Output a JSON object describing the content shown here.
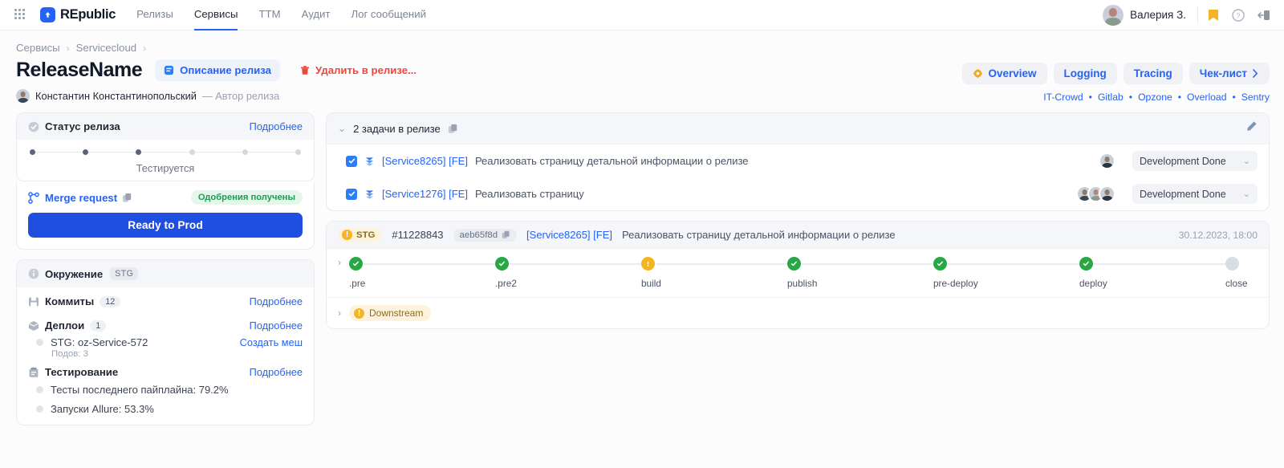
{
  "topnav": {
    "brand": "REpublic",
    "links": [
      {
        "label": "Релизы",
        "active": false
      },
      {
        "label": "Сервисы",
        "active": true
      },
      {
        "label": "TTM",
        "active": false
      },
      {
        "label": "Аудит",
        "active": false
      },
      {
        "label": "Лог сообщений",
        "active": false
      }
    ],
    "user": "Валерия З.",
    "icons": [
      "grid-icon",
      "bookmark-icon",
      "help-icon",
      "logout-icon"
    ],
    "bookmark_color": "#f5b424"
  },
  "breadcrumb": {
    "items": [
      "Сервисы",
      "Servicecloud"
    ],
    "sep": "›"
  },
  "header": {
    "title": "ReleaseName",
    "description_button": "Описание релиза",
    "delete_button": "Удалить в релизе...",
    "author_name": "Константин Константинопольский",
    "author_role": "— Автор релиза"
  },
  "right_head": {
    "tabs": [
      {
        "label": "Overview",
        "icon": "grafana-icon"
      },
      {
        "label": "Logging",
        "icon": ""
      },
      {
        "label": "Tracing",
        "icon": ""
      },
      {
        "label": "Чек-лист",
        "icon": "chevron-right-icon"
      }
    ],
    "links": [
      "IT-Crowd",
      "Gitlab",
      "Opzone",
      "Overload",
      "Sentry"
    ]
  },
  "status_card": {
    "title": "Статус релиза",
    "more": "Подробнее",
    "steps_total": 6,
    "steps_done": 3,
    "current_label": "Тестируется"
  },
  "merge_card": {
    "link": "Merge request",
    "badge": "Одобрения получены",
    "button": "Ready to Prod"
  },
  "env_card": {
    "title": "Окружение",
    "tag": "STG",
    "sections": [
      {
        "label": "Коммиты",
        "count": "12",
        "more": "Подробнее",
        "items": []
      },
      {
        "label": "Деплои",
        "count": "1",
        "more": "Подробнее",
        "items": [
          {
            "text": "STG: oz-Service-572",
            "action": "Создать меш",
            "note": "Подов: 3"
          }
        ]
      },
      {
        "label": "Тестирование",
        "count": "",
        "more": "Подробнее",
        "items": [
          {
            "text": "Тесты последнего пайплайна: 79.2%",
            "action": "",
            "note": ""
          },
          {
            "text": "Запуски Allure: 53.3%",
            "action": "",
            "note": ""
          }
        ]
      }
    ]
  },
  "tasks": {
    "header": "2 задачи в релизе",
    "rows": [
      {
        "key": "[Service8265] [FE]",
        "text": "Реализовать страницу детальной информации о релизе",
        "status": "Development Done",
        "avatars": 1
      },
      {
        "key": "[Service1276] [FE]",
        "text": "Реализовать страницу",
        "status": "Development Done",
        "avatars": 3
      }
    ]
  },
  "pipeline": {
    "env": "STG",
    "number": "#11228843",
    "sha": "aeb65f8d",
    "key": "[Service8265] [FE]",
    "text": "Реализовать страницу детальной информации о релизе",
    "time": "30.12.2023, 18:00",
    "stages": [
      {
        "name": ".pre",
        "state": "ok"
      },
      {
        "name": ".pre2",
        "state": "ok"
      },
      {
        "name": "build",
        "state": "warn"
      },
      {
        "name": "publish",
        "state": "ok"
      },
      {
        "name": "pre-deploy",
        "state": "ok"
      },
      {
        "name": "deploy",
        "state": "ok"
      },
      {
        "name": "close",
        "state": "idle"
      }
    ],
    "downstream": "Downstream"
  },
  "colors": {
    "accent": "#2563f6",
    "primary_btn": "#1f4fe0",
    "danger": "#e8493f",
    "ok": "#28a745",
    "warn": "#f5b424",
    "idle": "#d8dde4"
  }
}
